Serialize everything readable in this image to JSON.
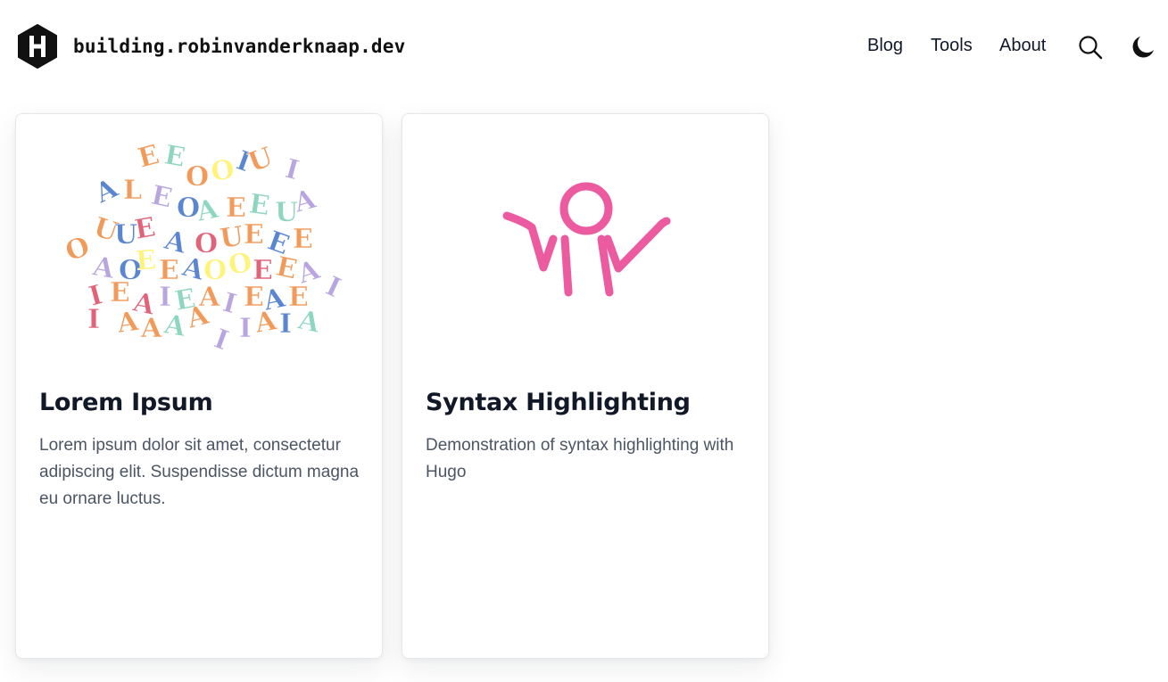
{
  "header": {
    "logo_icon": "hexagon-h-logo-icon",
    "site_title": "building.robinvanderknaap.dev",
    "nav": [
      {
        "label": "Blog"
      },
      {
        "label": "Tools"
      },
      {
        "label": "About"
      }
    ],
    "search_icon": "search-icon",
    "theme_icon": "moon-icon"
  },
  "cards": [
    {
      "title": "Lorem Ipsum",
      "description": "Lorem ipsum dolor sit amet, consectetur adipiscing elit. Suspendisse dictum magna eu ornare luctus.",
      "image": "colorful-letters-image"
    },
    {
      "title": "Syntax Highlighting",
      "description": "Demonstration of syntax highlighting with Hugo",
      "image": "pink-stick-figure-shrug-image"
    }
  ],
  "colors": {
    "text": "#111827",
    "muted": "#4b5563",
    "border": "#e5e7eb",
    "figure_pink": "#ec5aa0"
  }
}
